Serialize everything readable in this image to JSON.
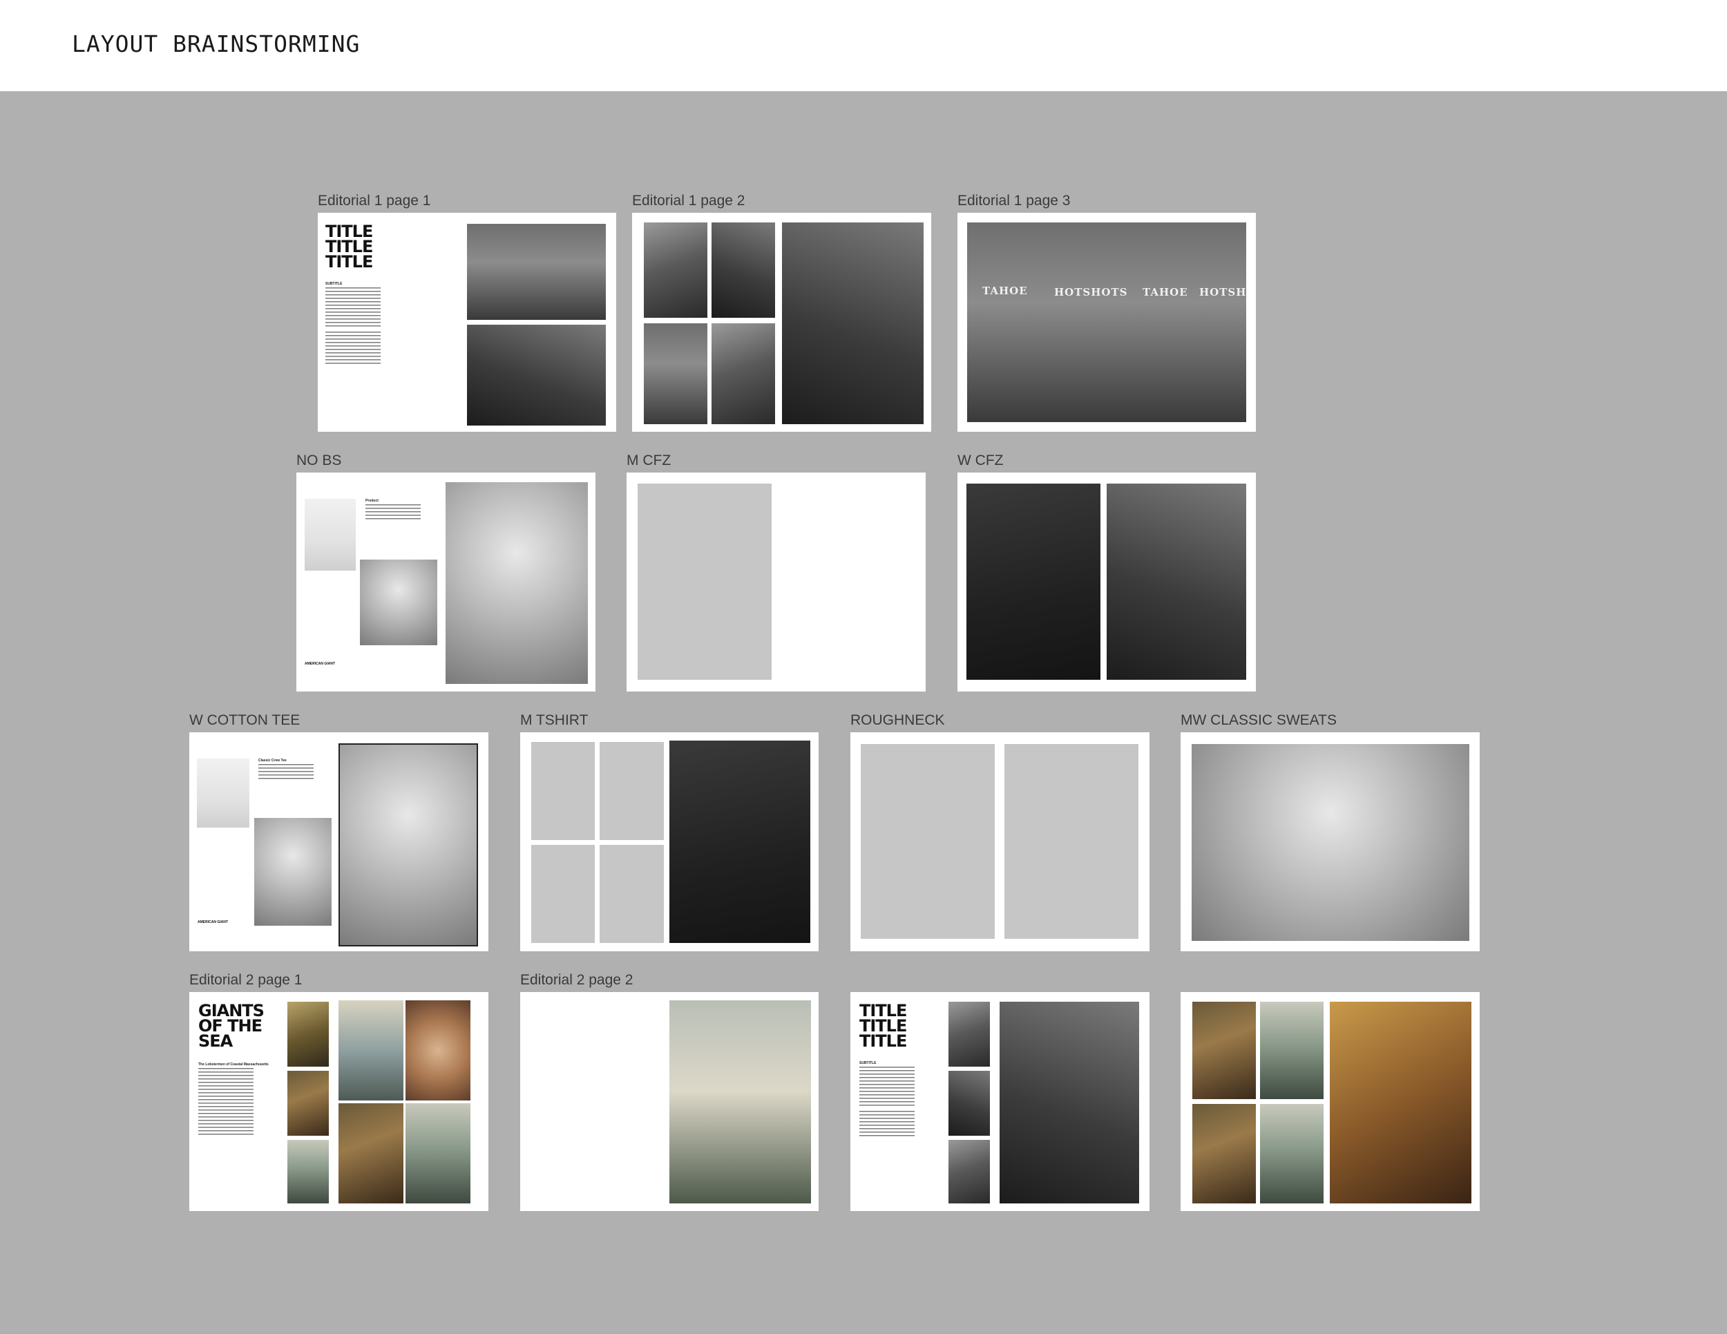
{
  "header": {
    "title": "LAYOUT BRAINSTORMING"
  },
  "frames": {
    "editorial1_page1": {
      "label": "Editorial 1 page 1",
      "title_text": "TITLE\nTITLE\nTITLE",
      "subtitle": "SUBTITLE"
    },
    "editorial1_page2": {
      "label": "Editorial 1 page 2"
    },
    "editorial1_page3": {
      "label": "Editorial 1 page 3",
      "banner_words": [
        "TAHOE",
        "HOTSHOTS",
        "TAHOE",
        "HOTSHOTS"
      ]
    },
    "no_bs": {
      "label": "NO BS",
      "heading": "Product",
      "footer_tag": "AMERICAN GIANT"
    },
    "m_cfz": {
      "label": "M CFZ"
    },
    "w_cfz": {
      "label": "W CFZ"
    },
    "w_cotton_tee": {
      "label": "W COTTON TEE",
      "heading": "Classic Crew Tee",
      "footer_tag": "AMERICAN GIANT"
    },
    "m_tshirt": {
      "label": "M TSHIRT"
    },
    "roughneck": {
      "label": "ROUGHNECK"
    },
    "mw_classic_sweats": {
      "label": "MW CLASSIC SWEATS"
    },
    "editorial2_page1": {
      "label": "Editorial 2 page 1",
      "title_text": "GIANTS\nOF THE\nSEA",
      "subtitle": "The Lobstermen of Coastal Massachusetts"
    },
    "editorial2_page2": {
      "label": "Editorial 2 page 2"
    },
    "editorial2_page3": {
      "title_text": "TITLE\nTITLE\nTITLE",
      "subtitle": "SUBTITLE"
    },
    "editorial2_page4": {}
  }
}
